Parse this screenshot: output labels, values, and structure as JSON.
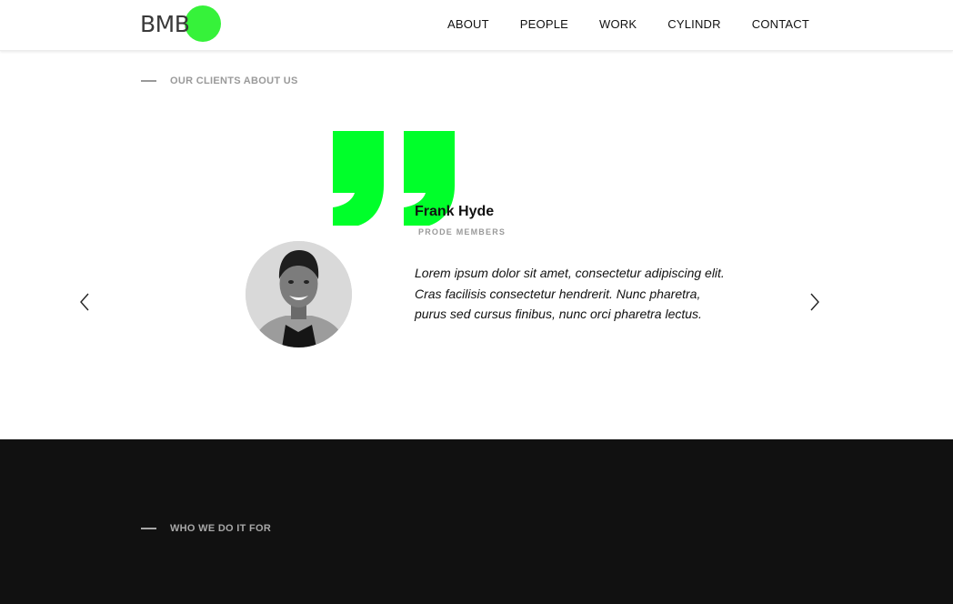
{
  "brand": {
    "logo_text": "BMB",
    "accent_color": "#00ff2a",
    "logo_dot_color": "#36f23a"
  },
  "nav": {
    "items": [
      "ABOUT",
      "PEOPLE",
      "WORK",
      "CYLINDR",
      "CONTACT"
    ]
  },
  "testimonials": {
    "section_label": "OUR CLIENTS ABOUT US",
    "name": "Frank Hyde",
    "role": "PRODE MEMBERS",
    "quote": "Lorem ipsum dolor sit amet, consectetur adipiscing elit. Cras facilisis consectetur hendrerit. Nunc pharetra, purus sed cursus finibus, nunc orci pharetra lectus.",
    "prev_icon": "chevron-left-icon",
    "next_icon": "chevron-right-icon"
  },
  "clients_section": {
    "section_label": "WHO WE DO IT FOR",
    "background_color": "#111111"
  }
}
